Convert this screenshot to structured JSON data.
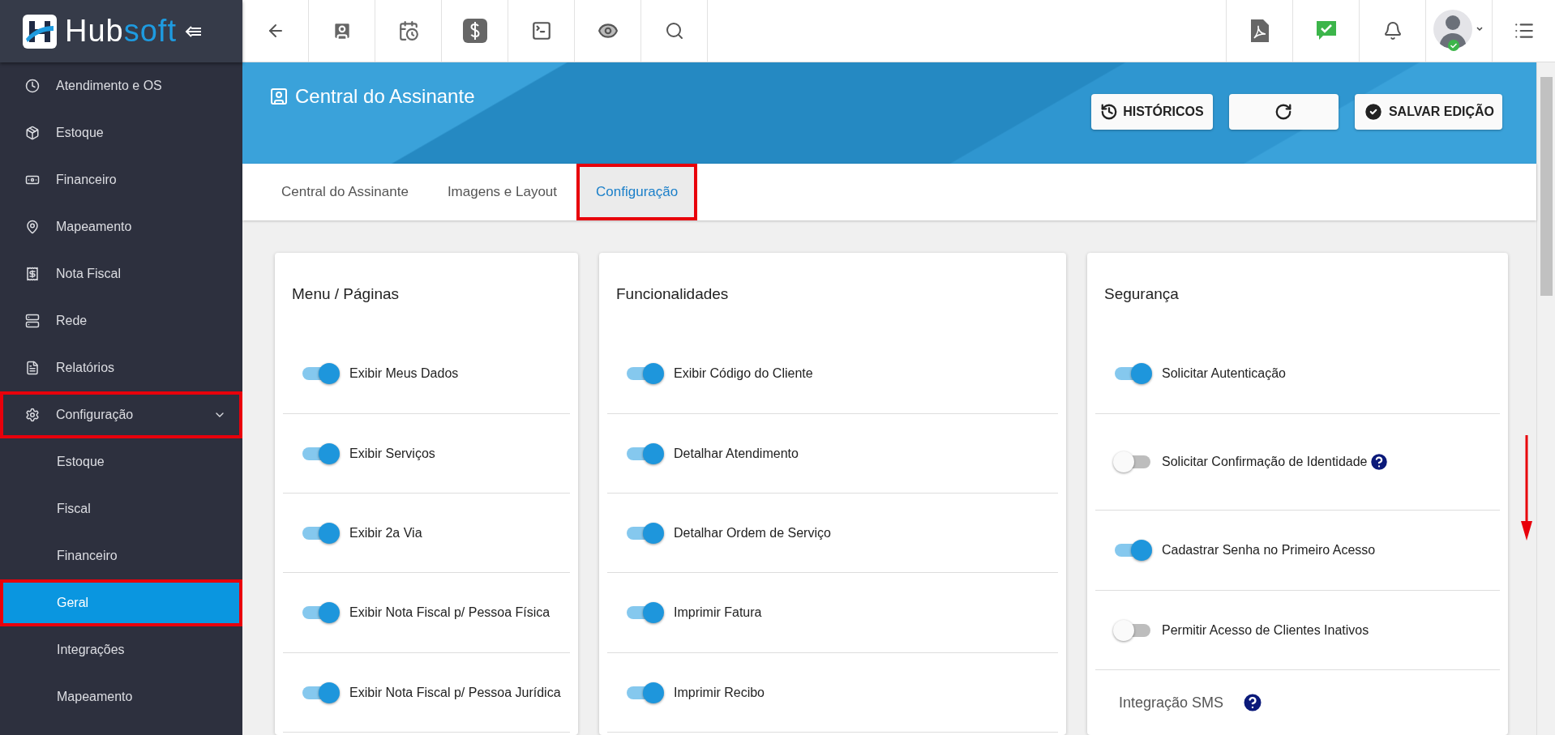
{
  "sidebar": {
    "logo": {
      "part_a": "Hub",
      "part_b": "soft"
    },
    "items": [
      {
        "label": "Atendimento e OS",
        "selected": false,
        "highlighted": false
      },
      {
        "label": "Estoque",
        "selected": false,
        "highlighted": false
      },
      {
        "label": "Financeiro",
        "selected": false,
        "highlighted": false
      },
      {
        "label": "Mapeamento",
        "selected": false,
        "highlighted": false
      },
      {
        "label": "Nota Fiscal",
        "selected": false,
        "highlighted": false
      },
      {
        "label": "Rede",
        "selected": false,
        "highlighted": false
      },
      {
        "label": "Relatórios",
        "selected": false,
        "highlighted": false
      },
      {
        "label": "Configuração",
        "selected": false,
        "highlighted": true,
        "expanded": true,
        "children": [
          {
            "label": "Estoque",
            "selected": false,
            "highlighted": false
          },
          {
            "label": "Fiscal",
            "selected": false,
            "highlighted": false
          },
          {
            "label": "Financeiro",
            "selected": false,
            "highlighted": false
          },
          {
            "label": "Geral",
            "selected": true,
            "highlighted": true
          },
          {
            "label": "Integrações",
            "selected": false,
            "highlighted": false
          },
          {
            "label": "Mapeamento",
            "selected": false,
            "highlighted": false
          }
        ]
      }
    ]
  },
  "header": {
    "title": "Central do Assinante",
    "buttons": [
      {
        "kind": "history",
        "label": "HISTÓRICOS"
      },
      {
        "kind": "refresh"
      },
      {
        "kind": "save",
        "label": "SALVAR EDIÇÃO"
      }
    ]
  },
  "tabs": [
    {
      "label": "Central do Assinante",
      "selected": false,
      "highlighted": false
    },
    {
      "label": "Imagens e Layout",
      "selected": false,
      "highlighted": false
    },
    {
      "label": "Configuração",
      "selected": true,
      "highlighted": true
    }
  ],
  "cards": [
    {
      "title": "Menu / Páginas",
      "rows": [
        {
          "label": "Exibir Meus Dados",
          "on": true,
          "help": false
        },
        {
          "label": "Exibir Serviços",
          "on": true,
          "help": false
        },
        {
          "label": "Exibir 2a Via",
          "on": true,
          "help": false
        },
        {
          "label": "Exibir Nota Fiscal p/ Pessoa Física",
          "on": true,
          "help": false
        },
        {
          "label": "Exibir Nota Fiscal p/ Pessoa Jurídica",
          "on": true,
          "help": false
        }
      ]
    },
    {
      "title": "Funcionalidades",
      "rows": [
        {
          "label": "Exibir Código do Cliente",
          "on": true,
          "help": false
        },
        {
          "label": "Detalhar Atendimento",
          "on": true,
          "help": false
        },
        {
          "label": "Detalhar Ordem de Serviço",
          "on": true,
          "help": false
        },
        {
          "label": "Imprimir Fatura",
          "on": true,
          "help": false
        },
        {
          "label": "Imprimir Recibo",
          "on": true,
          "help": false
        }
      ]
    },
    {
      "title": "Segurança",
      "rows": [
        {
          "label": "Solicitar Autenticação",
          "on": true,
          "help": false
        },
        {
          "label": "Solicitar Confirmação de Identidade",
          "on": false,
          "help": true
        },
        {
          "label": "Cadastrar Senha no Primeiro Acesso",
          "on": true,
          "help": false
        },
        {
          "label": "Permitir Acesso de Clientes Inativos",
          "on": false,
          "help": false
        }
      ],
      "section": {
        "label": "Integração SMS",
        "help": true
      }
    }
  ]
}
